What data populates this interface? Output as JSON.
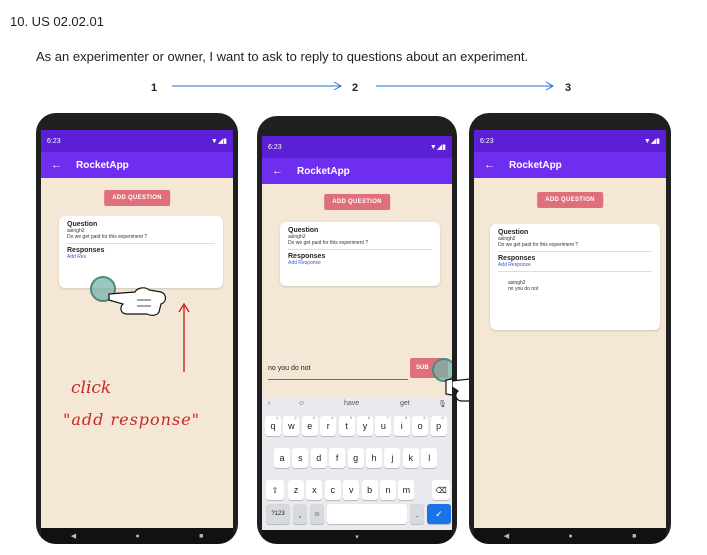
{
  "heading": "10. US 02.02.01",
  "story": "As an experimenter or owner, I want to ask to reply to questions about an experiment.",
  "steps": [
    "1",
    "2",
    "3"
  ],
  "colors": {
    "accent_arrow": "#1e6fd9",
    "appbar": "#6e2ef0",
    "statusbar": "#5b20d6",
    "button": "#e06f7c",
    "screen_bg": "#f4e7d5",
    "handwriting": "#c62828"
  },
  "phone": {
    "time": "6:23",
    "app_title": "RocketApp",
    "add_question": "ADD QUESTION",
    "question_heading": "Question",
    "question_user": "asingh2",
    "question_text": "Do we get paid for this experiment ?",
    "responses_heading": "Responses",
    "add_response": "Add Response",
    "add_response_partial": "Add Res",
    "reply_user": "asingh2",
    "reply_text": "no you do not",
    "input_value": "no you do not",
    "submit_partial": "SUB"
  },
  "annotation": {
    "line1": "click",
    "line2": "\"add response\""
  },
  "keyboard": {
    "suggestions": [
      "have",
      "get"
    ],
    "row1": [
      "q",
      "w",
      "e",
      "r",
      "t",
      "y",
      "u",
      "i",
      "o",
      "p"
    ],
    "row1_nums": [
      "1",
      "2",
      "3",
      "4",
      "5",
      "6",
      "7",
      "8",
      "9",
      "0"
    ],
    "row2": [
      "a",
      "s",
      "d",
      "f",
      "g",
      "h",
      "j",
      "k",
      "l"
    ],
    "row3": [
      "z",
      "x",
      "c",
      "v",
      "b",
      "n",
      "m"
    ],
    "sym_key": "?123",
    "comma": ","
  }
}
